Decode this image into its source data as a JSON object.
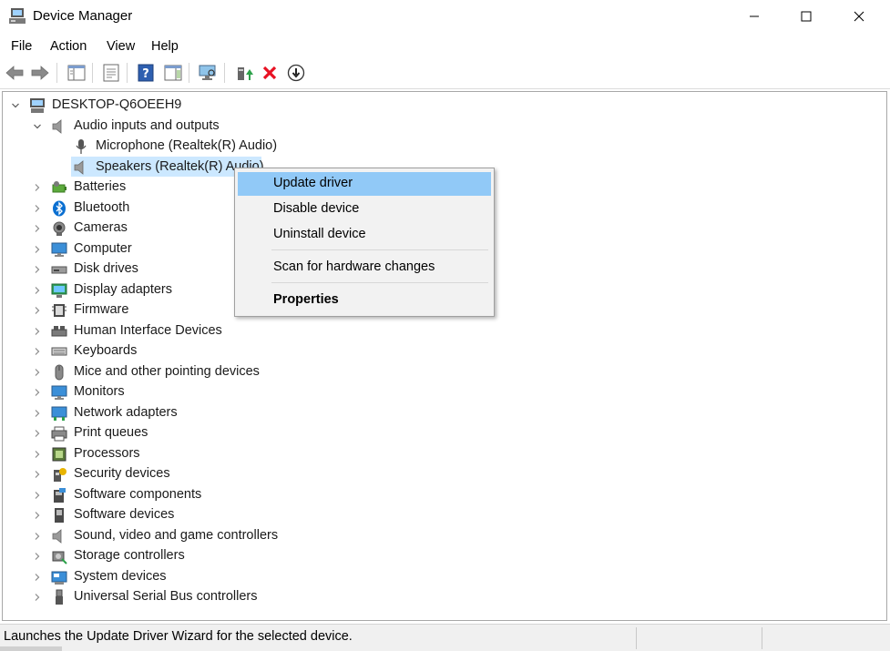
{
  "window": {
    "title": "Device Manager",
    "minimize_icon": "minimize-icon",
    "maximize_icon": "maximize-icon",
    "close_icon": "close-icon"
  },
  "menu": [
    "File",
    "Action",
    "View",
    "Help"
  ],
  "toolbar": {
    "icons": [
      "back-arrow-icon",
      "forward-arrow-icon",
      "show-hide-console-tree-icon",
      "properties-icon",
      "help-icon",
      "action-pane-icon",
      "scan-hardware-icon",
      "update-driver-icon",
      "uninstall-device-icon",
      "download-icon"
    ]
  },
  "tree": {
    "root": "DESKTOP-Q6OEEH9",
    "audio_category": "Audio inputs and outputs",
    "audio_children": [
      "Microphone (Realtek(R) Audio)",
      "Speakers (Realtek(R) Audio)"
    ],
    "categories": [
      "Batteries",
      "Bluetooth",
      "Cameras",
      "Computer",
      "Disk drives",
      "Display adapters",
      "Firmware",
      "Human Interface Devices",
      "Keyboards",
      "Mice and other pointing devices",
      "Monitors",
      "Network adapters",
      "Print queues",
      "Processors",
      "Security devices",
      "Software components",
      "Software devices",
      "Sound, video and game controllers",
      "Storage controllers",
      "System devices",
      "Universal Serial Bus controllers"
    ]
  },
  "context_menu": {
    "items": [
      "Update driver",
      "Disable device",
      "Uninstall device",
      "Scan for hardware changes",
      "Properties"
    ],
    "highlighted_index": 0
  },
  "status": {
    "text": "Launches the Update Driver Wizard for the selected device."
  },
  "colors": {
    "selection": "#cce8ff",
    "menu_highlight": "#91c9f7",
    "uninstall_red": "#e81123",
    "update_green": "#2da14a"
  }
}
